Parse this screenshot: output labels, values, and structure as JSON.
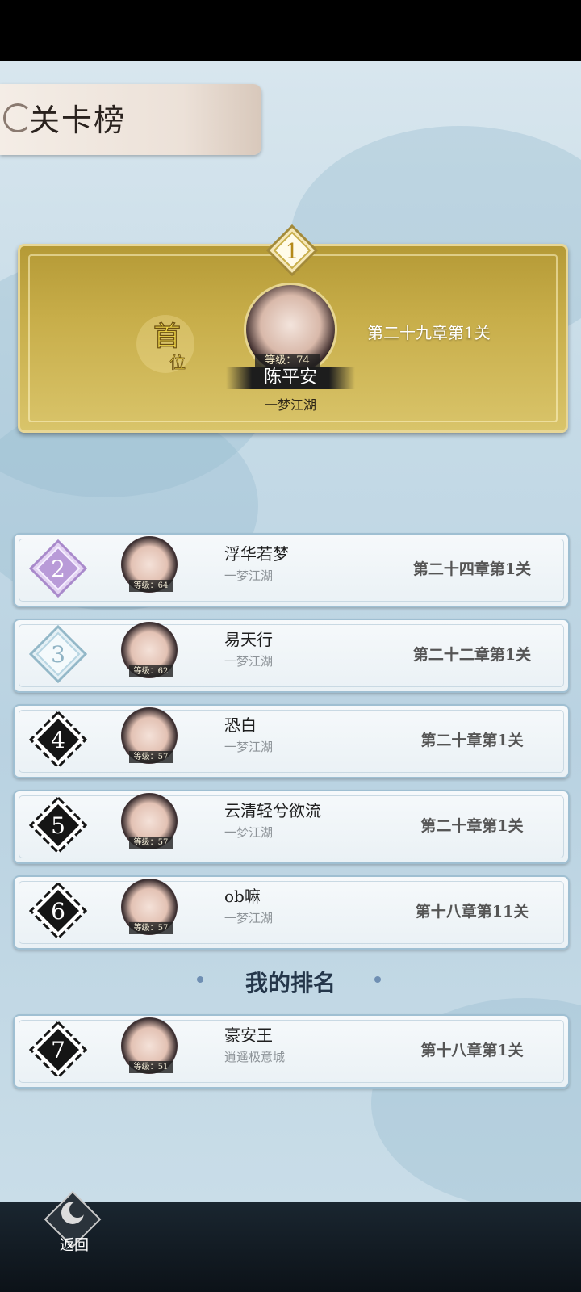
{
  "header": {
    "title": "关卡榜"
  },
  "champion": {
    "rank": "1",
    "first_place_mark": "首位",
    "level": "等级：74",
    "name": "陈平安",
    "guild": "一梦江湖",
    "stage": "第二十九章第1关"
  },
  "rankings": [
    {
      "rank": "2",
      "name": "浮华若梦",
      "guild": "一梦江湖",
      "level": "等级：64",
      "stage": "第二十四章第1关"
    },
    {
      "rank": "3",
      "name": "易天行",
      "guild": "一梦江湖",
      "level": "等级：62",
      "stage": "第二十二章第1关"
    },
    {
      "rank": "4",
      "name": "恐白",
      "guild": "一梦江湖",
      "level": "等级：57",
      "stage": "第二十章第1关"
    },
    {
      "rank": "5",
      "name": "云清轻兮欲流",
      "guild": "一梦江湖",
      "level": "等级：57",
      "stage": "第二十章第1关"
    },
    {
      "rank": "6",
      "name": "ob嘛",
      "guild": "一梦江湖",
      "level": "等级：57",
      "stage": "第十八章第11关"
    }
  ],
  "my_rank_label": "我的排名",
  "my_rank": {
    "rank": "7",
    "name": "豪安王",
    "guild": "逍遥极意城",
    "level": "等级：51",
    "stage": "第十八章第1关"
  },
  "footer": {
    "back_label": "返回"
  },
  "colors": {
    "gold": "#c8ae4a",
    "purple": "#b99bd8",
    "silver": "#b7d5e2",
    "dark": "#151515"
  }
}
